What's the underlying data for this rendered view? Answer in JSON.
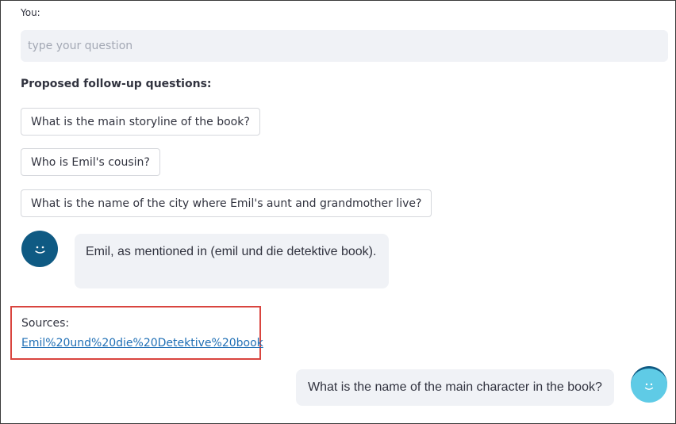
{
  "input": {
    "label": "You:",
    "placeholder": "type your question",
    "value": ""
  },
  "followups": {
    "title": "Proposed follow-up questions:",
    "questions": [
      "What is the main storyline of the book?",
      "Who is Emil's cousin?",
      "What is the name of the city where Emil's aunt and grandmother live?"
    ]
  },
  "chat": {
    "bot_message": "Emil, as mentioned in (emil und die detektive book).",
    "user_message": "What is the name of the main character in the book?",
    "bot_avatar_icon": "smiley-face-icon",
    "user_avatar_icon": "smiley-face-icon"
  },
  "sources": {
    "label": "Sources:",
    "link_text": "Emil%20und%20die%20Detektive%20book"
  },
  "colors": {
    "input_bg": "#f0f2f6",
    "bubble_bg": "#f0f2f6",
    "bot_avatar": "#0f5a83",
    "user_avatar": "#5fcbe6",
    "highlight_border": "#d9453f",
    "link": "#1f6fb5"
  }
}
